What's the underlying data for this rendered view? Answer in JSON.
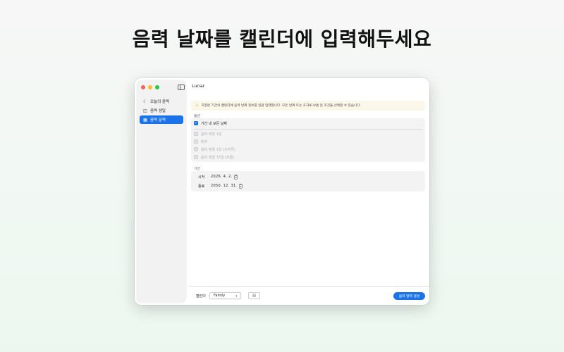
{
  "headline": "음력 날짜를 캘린더에 입력해두세요",
  "window": {
    "title": "Lunar"
  },
  "sidebar": {
    "items": [
      {
        "label": "오늘의 음력",
        "icon": "clock-lunar-icon",
        "icon_glyph": "☾"
      },
      {
        "label": "음력 생일",
        "icon": "cake-icon",
        "icon_glyph": "◫"
      },
      {
        "label": "음력 달력",
        "icon": "calendar-icon",
        "icon_glyph": "▦"
      }
    ],
    "active_index": 2
  },
  "notice": {
    "icon": "warning-icon",
    "icon_glyph": "⚠",
    "text": "지정된 기간의 캘린더에 음력 날짜 정보를 일괄 입력합니다. 모든 날짜 또는 초하루·보름 등 조건을 선택할 수 있습니다."
  },
  "options": {
    "label": "옵션",
    "items": [
      {
        "label": "기간 내 모든 날짜",
        "checked": true,
        "disabled": false
      },
      {
        "label": "음력 매월 1일",
        "checked": false,
        "disabled": true
      },
      {
        "label": "매주",
        "checked": false,
        "disabled": true
      },
      {
        "label": "음력 매월 1일 (초하루)",
        "checked": false,
        "disabled": true
      },
      {
        "label": "음력 매월 15일 (보름)",
        "checked": false,
        "disabled": true
      }
    ]
  },
  "period": {
    "label": "기간",
    "start_label": "시작",
    "start_value": "2026. 4. 2.",
    "end_label": "종료",
    "end_value": "2050. 12. 31."
  },
  "footer": {
    "calendar_label": "캘린더",
    "calendar_value": "Family",
    "calendar_button_icon": "calendar-add-icon",
    "generate_label": "음력 달력 생성"
  },
  "colors": {
    "accent": "#1a73e8",
    "close": "#ff5f57",
    "minimize": "#febc2e",
    "maximize": "#28c840",
    "notice_bg": "#fbf7e9"
  }
}
